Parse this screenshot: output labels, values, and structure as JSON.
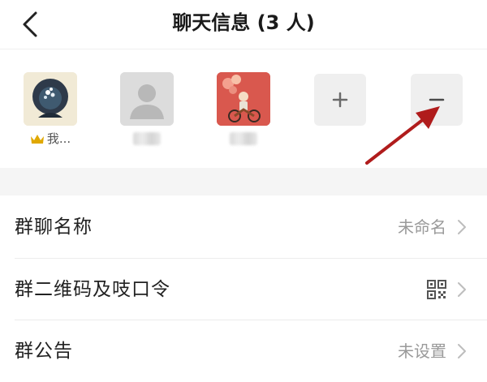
{
  "header": {
    "title": "聊天信息 (3 人)",
    "back_icon": "chevron-left-icon"
  },
  "members": [
    {
      "name": "我...",
      "badge_icon": "crown-icon",
      "avatar": "user-avatar-portrait"
    },
    {
      "name": "",
      "avatar": "default-avatar-icon"
    },
    {
      "name": "",
      "avatar": "user-avatar-illustration"
    }
  ],
  "member_actions": {
    "add_icon": "plus-icon",
    "remove_icon": "minus-icon"
  },
  "settings": [
    {
      "label": "群聊名称",
      "value": "未命名"
    },
    {
      "label": "群二维码及吱口令",
      "value": "",
      "icon": "qr-code-icon"
    },
    {
      "label": "群公告",
      "value": "未设置"
    }
  ],
  "colors": {
    "annotation_arrow": "#b01c1c",
    "crown": "#e0a800",
    "divider": "#ececec"
  }
}
